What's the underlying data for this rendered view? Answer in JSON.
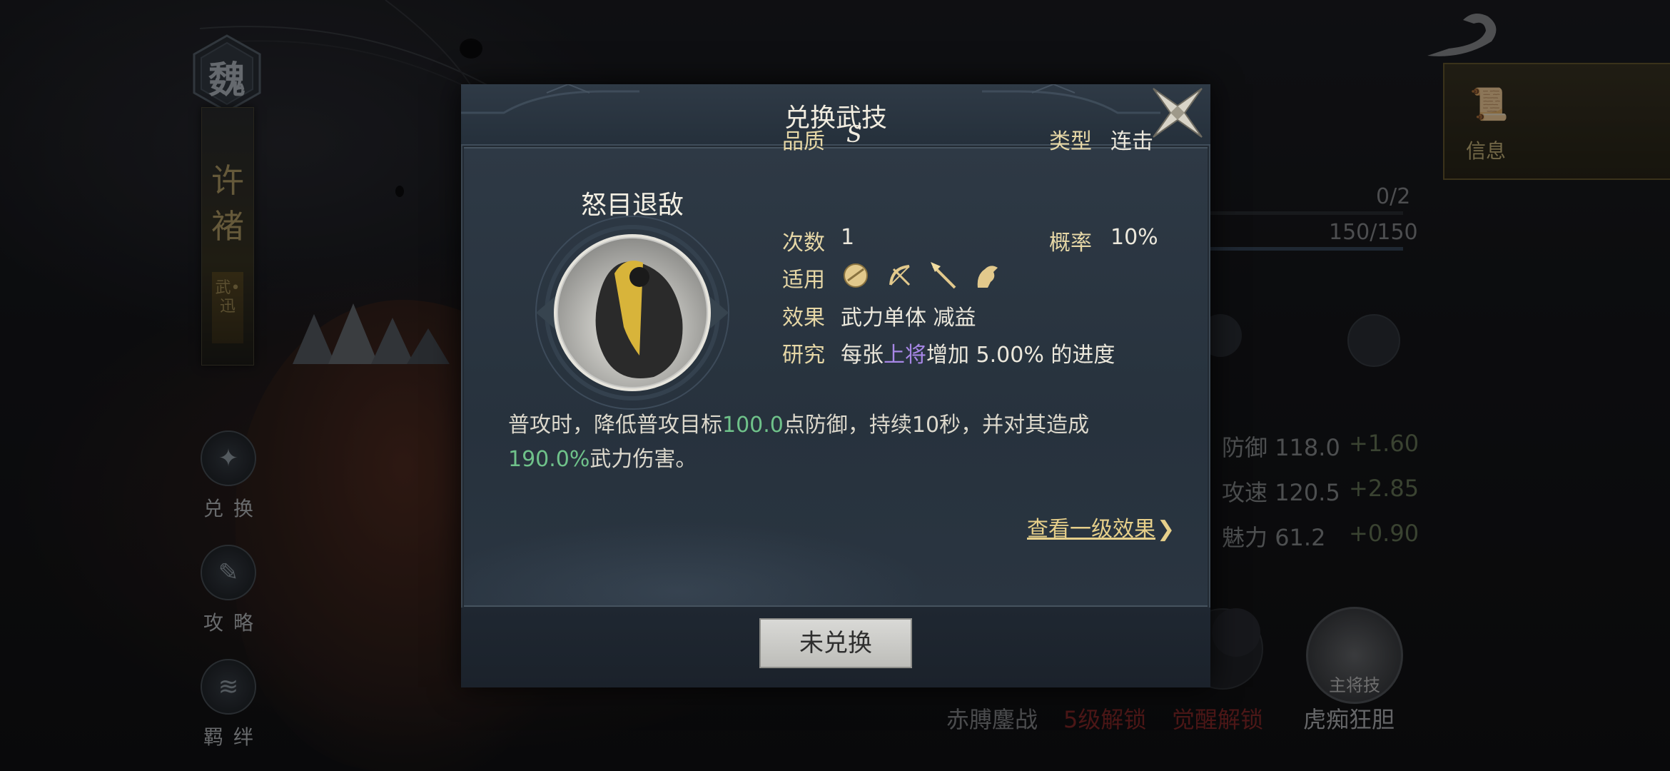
{
  "background": {
    "faction_char": "魏",
    "hero_name": "许褚",
    "hero_tag": "武•迅",
    "side_buttons": [
      {
        "label": "兑换",
        "icon": "exchange-icon"
      },
      {
        "label": "攻略",
        "icon": "guide-scroll-icon"
      },
      {
        "label": "羁绊",
        "icon": "bond-icon"
      }
    ],
    "info_tab_label": "信息",
    "progress_rows": [
      {
        "value": "0/2"
      },
      {
        "value": "150/150"
      }
    ],
    "stats": [
      {
        "name": "防御",
        "value": "118.0",
        "inc": "+1.60"
      },
      {
        "name": "攻速",
        "value": "120.5",
        "inc": "+2.85"
      },
      {
        "name": "魅力",
        "value": "61.2",
        "inc": "+0.90"
      }
    ],
    "skill_labels": [
      {
        "text": "赤膊鏖战",
        "color": "#8a8d90"
      },
      {
        "text": "5级解锁",
        "color": "#8a2a2a"
      },
      {
        "text": "觉醒解锁",
        "color": "#8a2a2a"
      },
      {
        "text": "虎痴狂胆",
        "color": "#b8bbbe"
      }
    ],
    "main_skill_badge": "主将技"
  },
  "modal": {
    "title": "兑换武技",
    "skill_name": "怒目退敌",
    "attributes": {
      "quality_label": "品质",
      "quality_value": "S",
      "type_label": "类型",
      "type_value": "连击",
      "count_label": "次数",
      "count_value": "1",
      "rate_label": "概率",
      "rate_value": "10%",
      "apply_label": "适用",
      "apply_icons": [
        "shield-icon",
        "bow-icon",
        "spear-icon",
        "horse-icon"
      ],
      "effect_label": "效果",
      "effect_value": "武力单体 减益",
      "research_label": "研究",
      "research_prefix": "每张",
      "research_highlight": "上将",
      "research_suffix": "增加 5.00% 的进度"
    },
    "description": {
      "part1": "普攻时，降低普攻目标",
      "value1": "100.0",
      "part2": "点防御，持续10秒，并对其造成",
      "value2": "190.0%",
      "part3": "武力伤害。"
    },
    "view_link": "查看一级效果",
    "view_link_chevron": "❯",
    "action_button": "未兑换"
  },
  "colors": {
    "accent_gold": "#e6cf8a",
    "highlight_green": "#6fc28a",
    "highlight_purple": "#a787e6"
  }
}
